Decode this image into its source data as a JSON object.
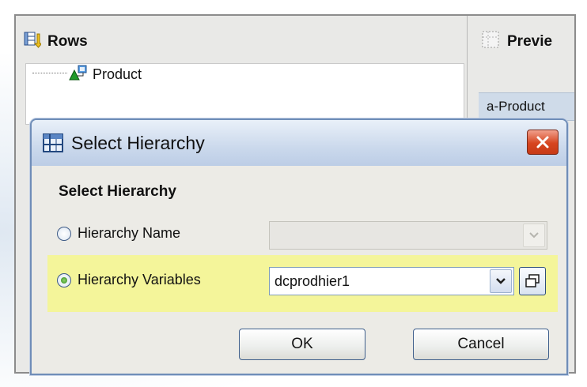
{
  "rows_panel": {
    "title": "Rows",
    "tree_item": "Product"
  },
  "preview_panel": {
    "title": "Previe",
    "cell": "a-Product"
  },
  "dialog": {
    "title": "Select Hierarchy",
    "group_title": "Select Hierarchy",
    "option_name": {
      "label": "Hierarchy Name",
      "checked": false,
      "value": ""
    },
    "option_variables": {
      "label": "Hierarchy Variables",
      "checked": true,
      "value": "dcprodhier1"
    },
    "ok_label": "OK",
    "cancel_label": "Cancel"
  },
  "colors": {
    "highlight": "#f4f59a",
    "selected_cell": "#cfdbe9",
    "close_button": "#d6451f"
  },
  "icons": [
    "rows-icon",
    "product-hierarchy-icon",
    "preview-icon",
    "dialog-table-icon",
    "close-icon",
    "dropdown-arrow-icon",
    "browse-icon"
  ]
}
